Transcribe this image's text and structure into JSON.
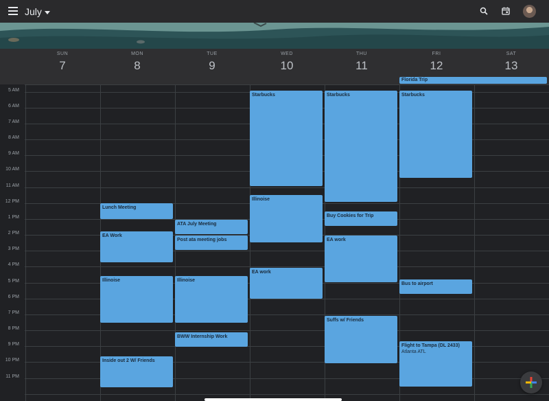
{
  "header": {
    "month": "July"
  },
  "colors": {
    "event": "#5aa5e0",
    "background": "#202124",
    "topbar": "#2a2a2c"
  },
  "icons": {
    "menu": "menu-icon",
    "search": "search-icon",
    "calendar": "calendar-today-icon",
    "add": "add-icon"
  },
  "days": [
    {
      "name": "SUN",
      "num": "7"
    },
    {
      "name": "MON",
      "num": "8"
    },
    {
      "name": "TUE",
      "num": "9"
    },
    {
      "name": "WED",
      "num": "10"
    },
    {
      "name": "THU",
      "num": "11"
    },
    {
      "name": "FRI",
      "num": "12"
    },
    {
      "name": "SAT",
      "num": "13"
    }
  ],
  "all_day_event": {
    "title": "Florida Trip"
  },
  "hours": [
    "5 AM",
    "6 AM",
    "7 AM",
    "8 AM",
    "9 AM",
    "10 AM",
    "11 AM",
    "12 PM",
    "1 PM",
    "2 PM",
    "3 PM",
    "4 PM",
    "5 PM",
    "6 PM",
    "7 PM",
    "8 PM",
    "9 PM",
    "10 PM",
    "11 PM"
  ],
  "events": [
    {
      "title": "Starbucks",
      "day": "WED",
      "start": "5 AM",
      "end": "11 AM"
    },
    {
      "title": "Illinoise",
      "day": "WED",
      "start": "11:30 AM",
      "end": "2:30 PM"
    },
    {
      "title": "EA work",
      "day": "WED",
      "start": "4 PM",
      "end": "6 PM"
    },
    {
      "title": "Starbucks",
      "day": "THU",
      "start": "5 AM",
      "end": "12 PM"
    },
    {
      "title": "Buy Cookies for Trip",
      "day": "THU",
      "start": "12:30 PM",
      "end": "1:30 PM"
    },
    {
      "title": "EA work",
      "day": "THU",
      "start": "2 PM",
      "end": "5 PM"
    },
    {
      "title": "Suffs w/ Friends",
      "day": "THU",
      "start": "7 PM",
      "end": "10 PM"
    },
    {
      "title": "Starbucks",
      "day": "FRI",
      "start": "5 AM",
      "end": "10:30 AM"
    },
    {
      "title": "Bus to airport",
      "day": "FRI",
      "start": "4:45 PM",
      "end": "5:45 PM"
    },
    {
      "title": "Flight to Tampa (DL 2433)",
      "subtitle": "Atlanta ATL",
      "day": "FRI",
      "start": "8:30 PM",
      "end": "11:30 PM"
    },
    {
      "title": "Lunch Meeting",
      "day": "MON",
      "start": "12 PM",
      "end": "1 PM"
    },
    {
      "title": "EA Work",
      "day": "MON",
      "start": "1:45 PM",
      "end": "3:45 PM"
    },
    {
      "title": "Illinoise",
      "day": "MON",
      "start": "4:30 PM",
      "end": "7:30 PM"
    },
    {
      "title": "Inside out 2 W/ Friends",
      "day": "MON",
      "start": "9:30 PM",
      "end": "11:30 PM"
    },
    {
      "title": "ATA July Meeting",
      "day": "TUE",
      "start": "1 PM",
      "end": "2 PM"
    },
    {
      "title": "Post ata meeting jobs",
      "day": "TUE",
      "start": "2 PM",
      "end": "3 PM"
    },
    {
      "title": "Illinoise",
      "day": "TUE",
      "start": "4:30 PM",
      "end": "7:30 PM"
    },
    {
      "title": "BWW Internship Work",
      "day": "TUE",
      "start": "8 PM",
      "end": "9 PM"
    }
  ]
}
